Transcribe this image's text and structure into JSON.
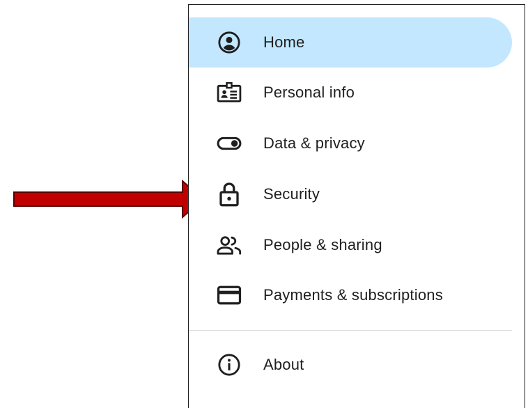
{
  "nav": {
    "items": [
      {
        "label": "Home",
        "icon": "account-circle-icon",
        "active": true
      },
      {
        "label": "Personal info",
        "icon": "id-card-icon"
      },
      {
        "label": "Data & privacy",
        "icon": "toggle-icon"
      },
      {
        "label": "Security",
        "icon": "lock-icon"
      },
      {
        "label": "People & sharing",
        "icon": "people-icon"
      },
      {
        "label": "Payments & subscriptions",
        "icon": "credit-card-icon"
      }
    ],
    "footer_items": [
      {
        "label": "About",
        "icon": "info-icon"
      }
    ]
  },
  "annotation": {
    "arrow_color": "#c00000",
    "points_to": "Security"
  },
  "colors": {
    "active_bg": "#c2e7ff",
    "text": "#1f1f1f",
    "divider": "#dadce0"
  }
}
